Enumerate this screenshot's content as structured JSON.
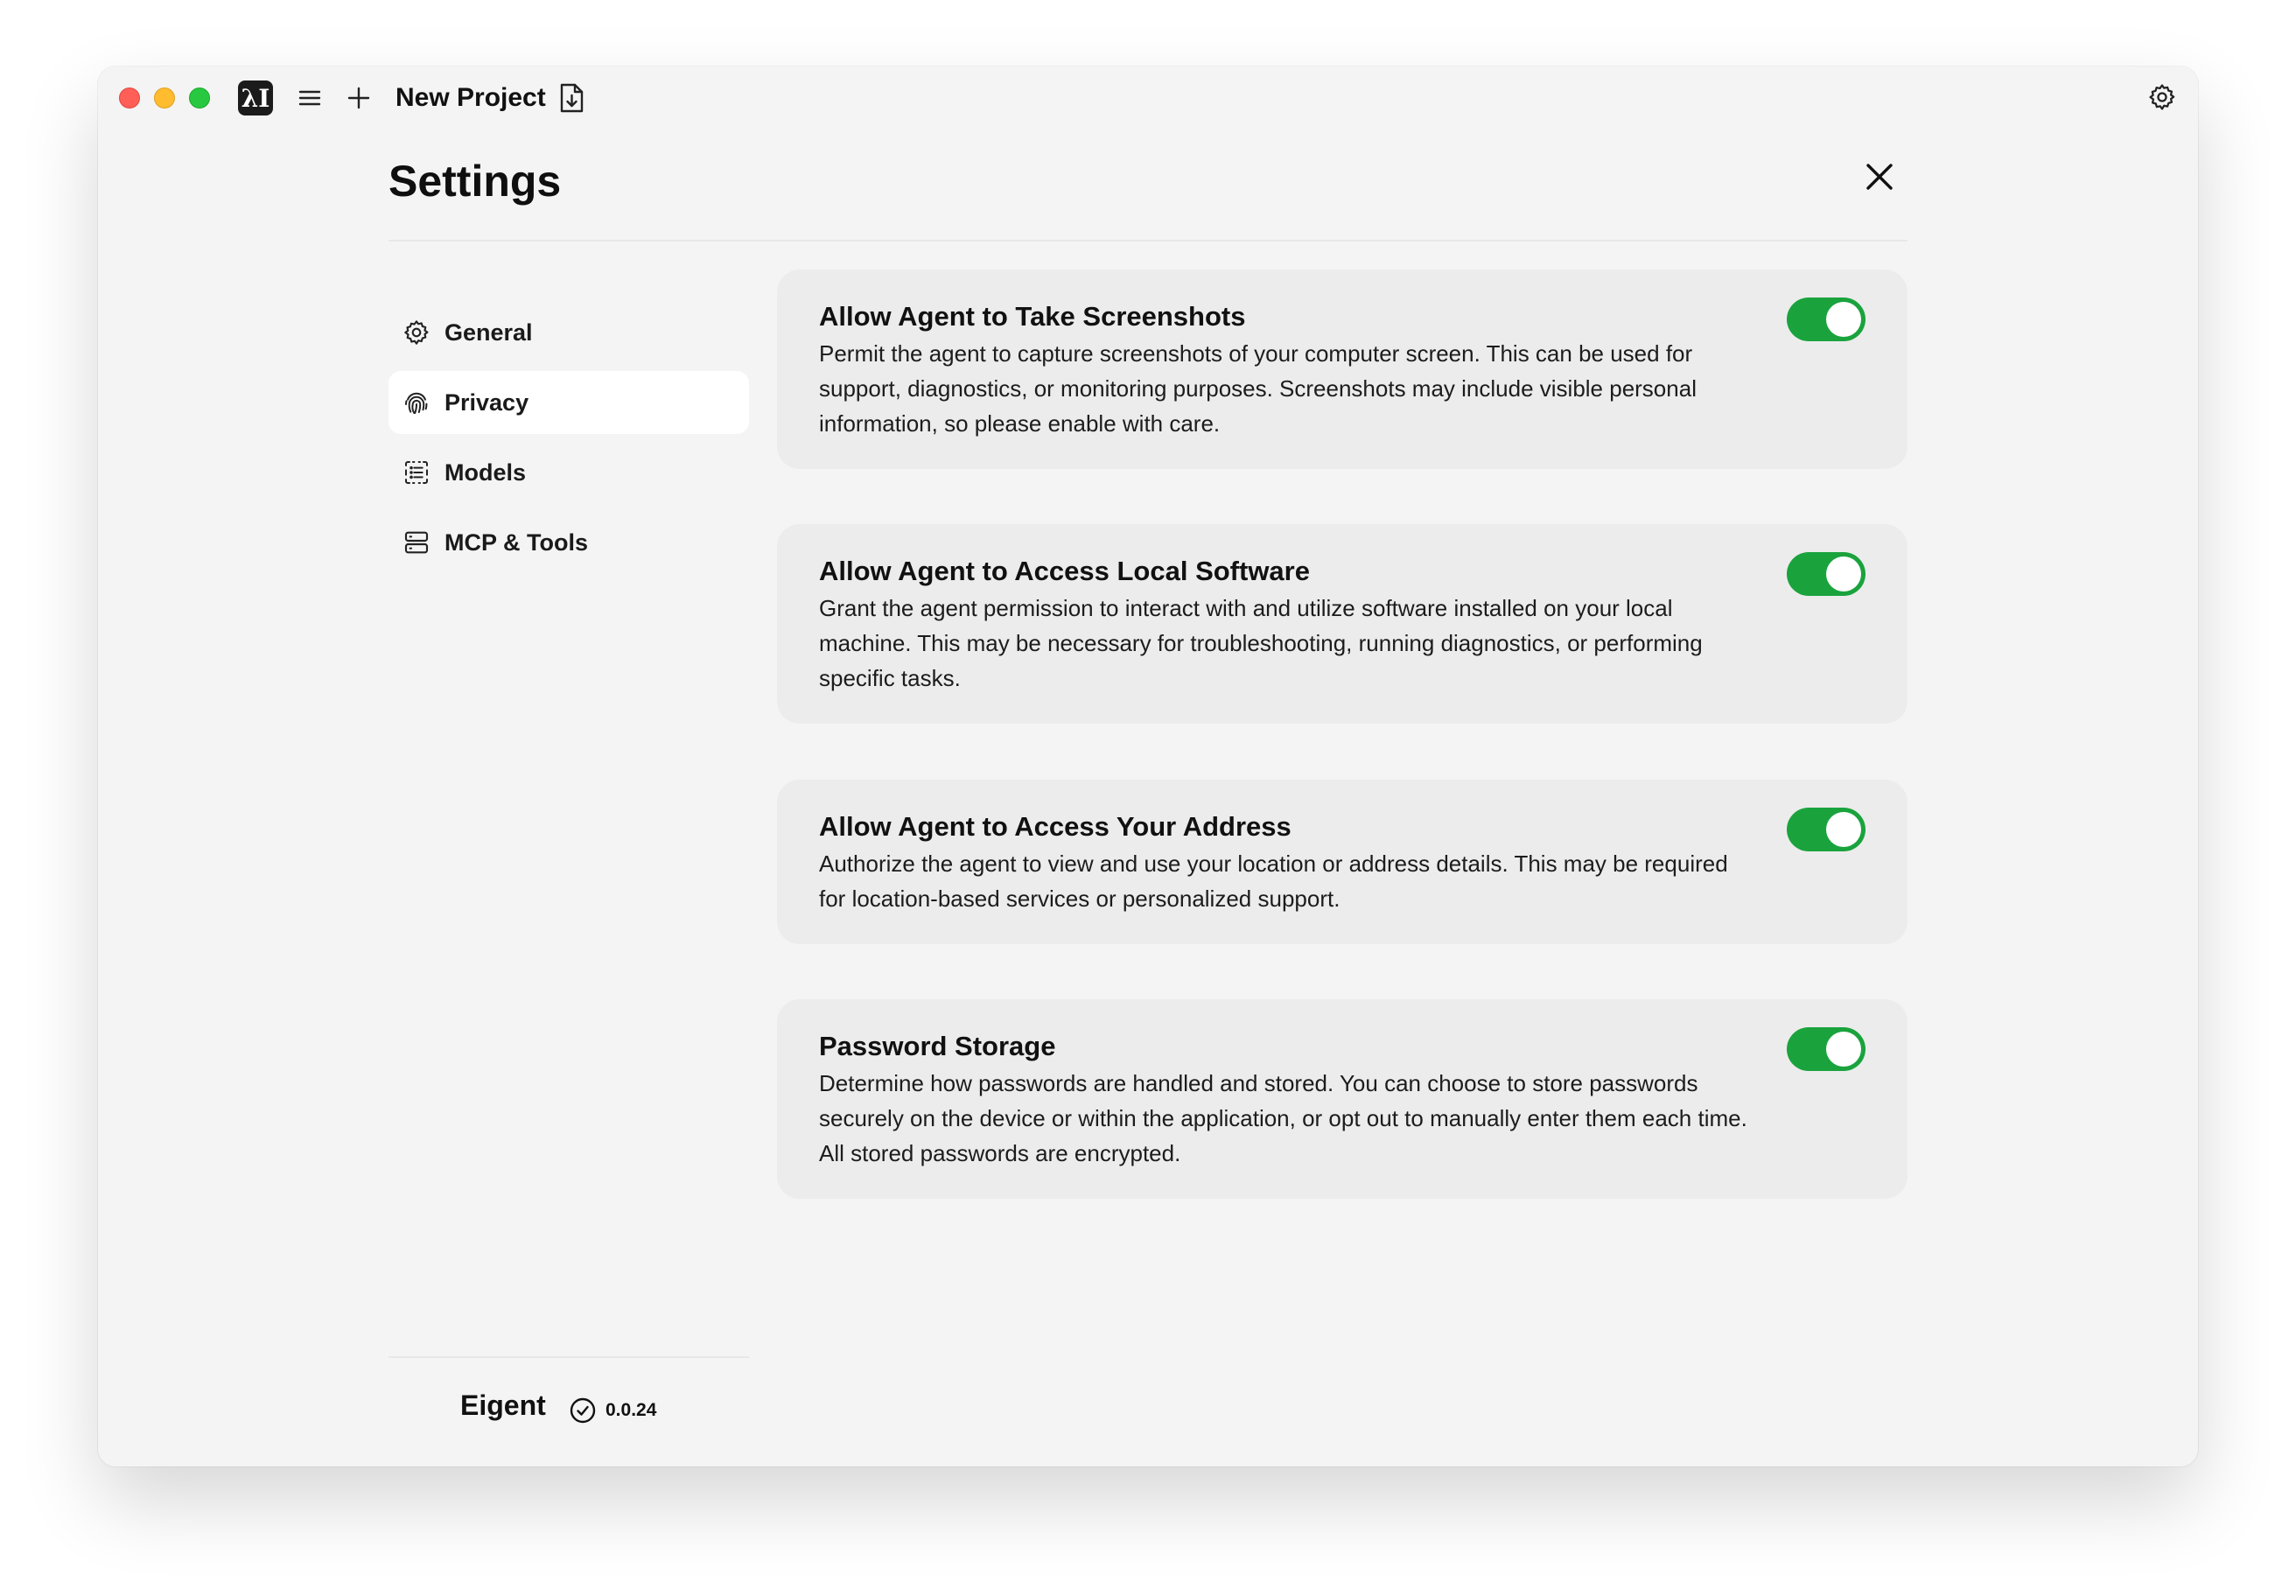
{
  "titlebar": {
    "project_title": "New Project",
    "logo_text": "λI"
  },
  "settings": {
    "title": "Settings"
  },
  "sidebar": {
    "items": [
      {
        "label": "General",
        "icon": "gear-icon",
        "active": false
      },
      {
        "label": "Privacy",
        "icon": "fingerprint-icon",
        "active": true
      },
      {
        "label": "Models",
        "icon": "list-icon",
        "active": false
      },
      {
        "label": "MCP & Tools",
        "icon": "server-icon",
        "active": false
      }
    ]
  },
  "cards": [
    {
      "title": "Allow Agent to Take Screenshots",
      "description": "Permit the agent to capture screenshots of your computer screen. This can be used for support, diagnostics, or monitoring purposes. Screenshots may include visible personal information, so please enable with care.",
      "enabled": true
    },
    {
      "title": "Allow Agent to Access Local Software",
      "description": "Grant the agent permission to interact with and utilize software installed on your local machine. This may be necessary for troubleshooting, running diagnostics, or performing specific tasks.",
      "enabled": true
    },
    {
      "title": "Allow Agent to Access Your Address",
      "description": "Authorize the agent to view and use your location or address details. This may be required for location-based services or personalized support.",
      "enabled": true
    },
    {
      "title": "Password Storage",
      "description": "Determine how passwords are handled and stored. You can choose to store passwords securely on the device or within the application, or opt out to manually enter them each time. All stored passwords are encrypted.",
      "enabled": true
    }
  ],
  "footer": {
    "brand": "Eigent",
    "version": "0.0.24"
  },
  "colors": {
    "toggle_on": "#1aa33d",
    "window_bg": "#f4f4f4",
    "card_bg": "#ececec"
  }
}
